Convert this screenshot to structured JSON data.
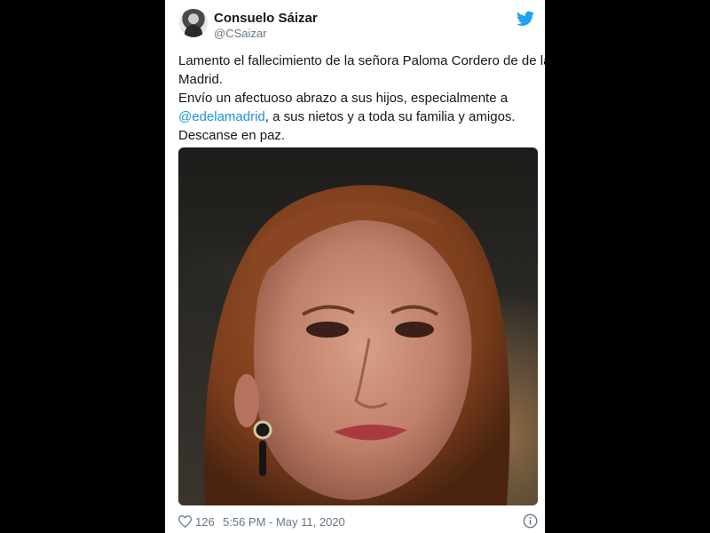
{
  "author": {
    "display_name": "Consuelo Sáizar",
    "handle": "@CSaizar"
  },
  "tweet": {
    "lines": [
      "Lamento el fallecimiento de la señora Paloma Cordero de de la",
      "Madrid.",
      "Envío un afectuoso abrazo a sus hijos, especialmente a"
    ],
    "mention": "@edelamadrid",
    "mention_after": ", a sus nietos y a toda su familia y amigos.",
    "closing": "Descanse en paz."
  },
  "footer": {
    "likes": "126",
    "timestamp": "5:56 PM - May 11, 2020"
  },
  "icons": {
    "brand": "twitter-bird-icon",
    "like": "heart-icon",
    "info": "info-icon"
  },
  "colors": {
    "brand": "#1da1f2",
    "link": "#1b95e0",
    "text": "#14171a",
    "muted": "#657786"
  }
}
